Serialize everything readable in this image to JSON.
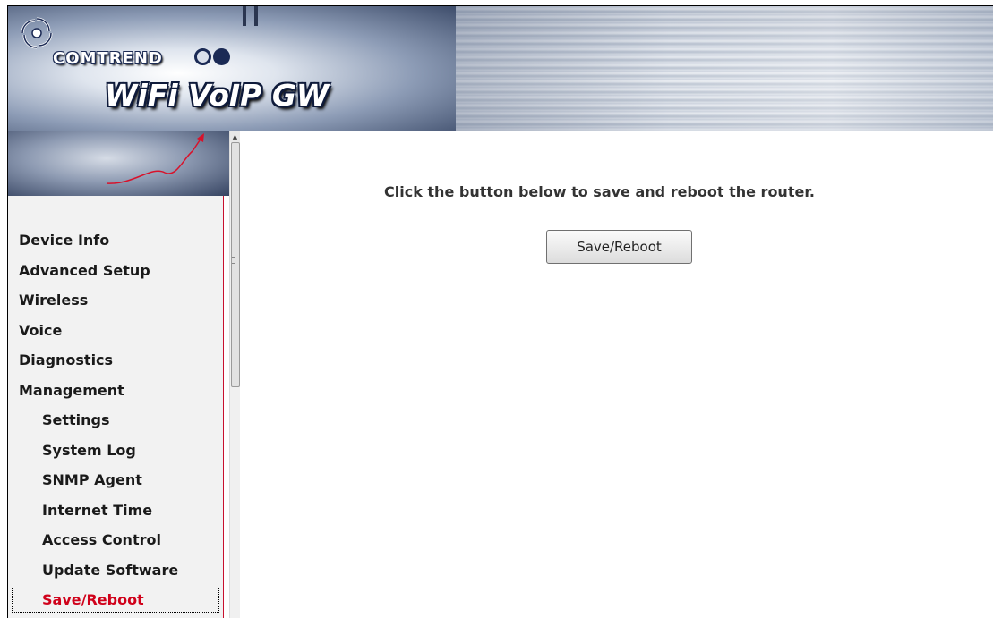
{
  "header": {
    "brand": "COMTREND",
    "product": "WiFi VoIP GW"
  },
  "sidebar": {
    "items": [
      {
        "label": "Device Info",
        "level": "top",
        "active": false
      },
      {
        "label": "Advanced Setup",
        "level": "top",
        "active": false
      },
      {
        "label": "Wireless",
        "level": "top",
        "active": false
      },
      {
        "label": "Voice",
        "level": "top",
        "active": false
      },
      {
        "label": "Diagnostics",
        "level": "top",
        "active": false
      },
      {
        "label": "Management",
        "level": "top",
        "active": false
      },
      {
        "label": "Settings",
        "level": "sub",
        "active": false
      },
      {
        "label": "System Log",
        "level": "sub",
        "active": false
      },
      {
        "label": "SNMP Agent",
        "level": "sub",
        "active": false
      },
      {
        "label": "Internet Time",
        "level": "sub",
        "active": false
      },
      {
        "label": "Access Control",
        "level": "sub",
        "active": false
      },
      {
        "label": "Update Software",
        "level": "sub",
        "active": false
      },
      {
        "label": "Save/Reboot",
        "level": "sub",
        "active": true
      }
    ]
  },
  "main": {
    "message": "Click the button below to save and reboot the router.",
    "button_label": "Save/Reboot"
  },
  "colors": {
    "active_menu": "#d0021b",
    "sidebar_border": "#c8102e",
    "sidebar_bg": "#f2f2f2"
  }
}
